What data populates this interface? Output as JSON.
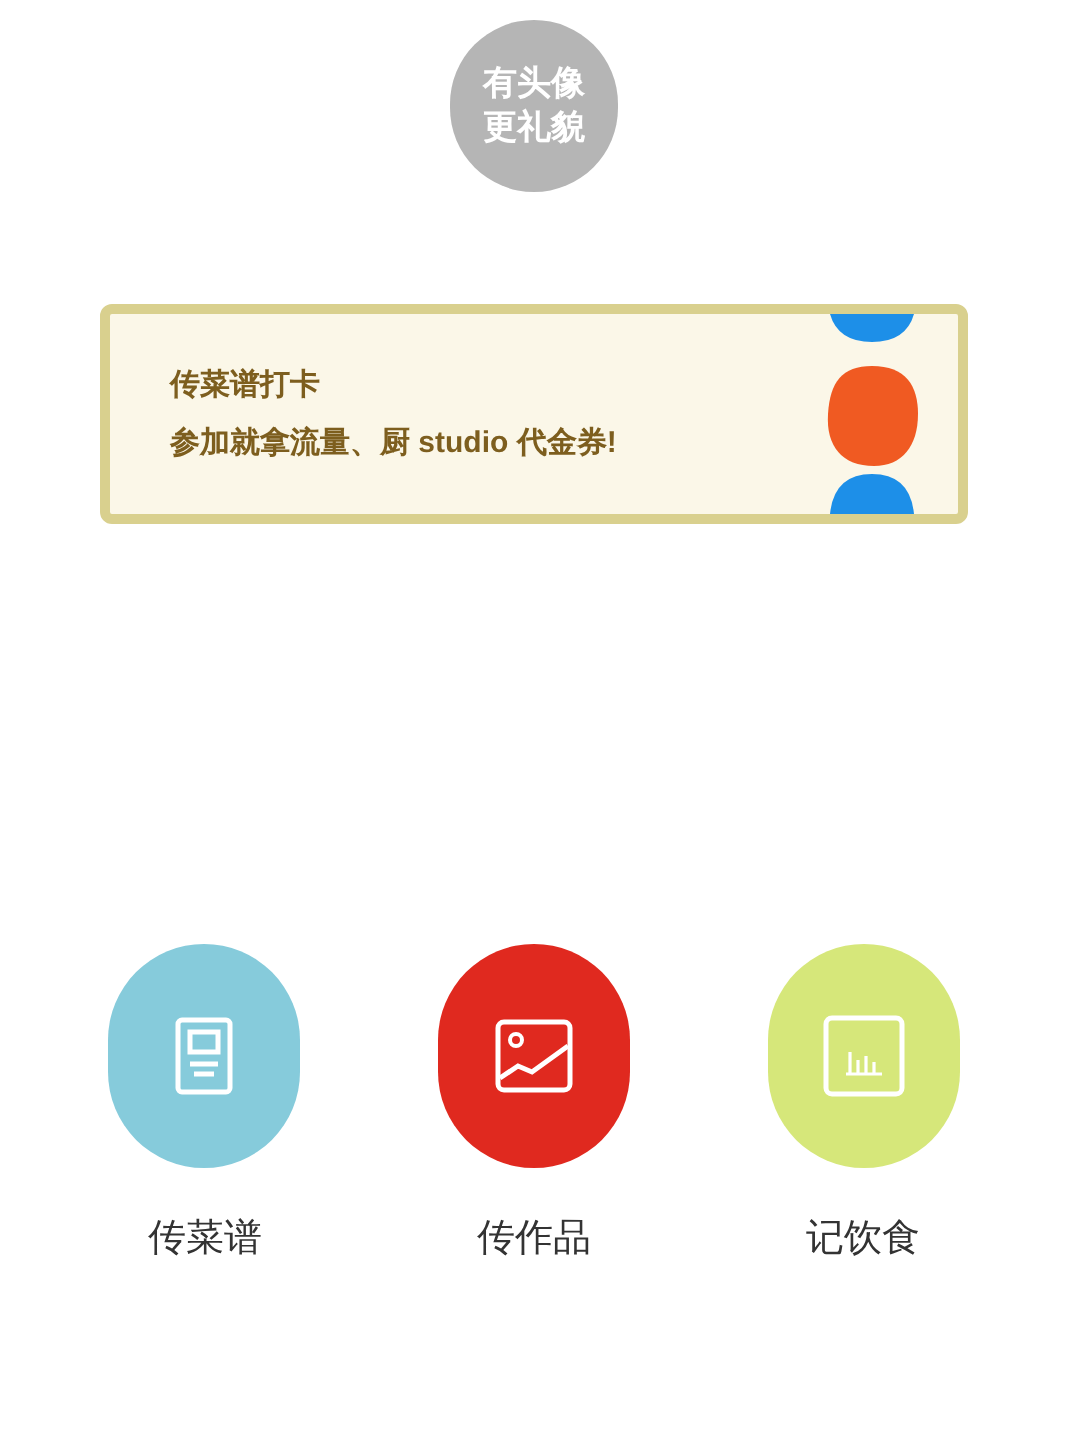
{
  "avatar": {
    "lines": [
      "有头像",
      "更礼貌"
    ]
  },
  "banner": {
    "title": "传菜谱打卡",
    "subtitle": "参加就拿流量、厨 studio 代金券!"
  },
  "actions": [
    {
      "kind": "recipe",
      "label": "传菜谱",
      "color": "#86cbdb"
    },
    {
      "kind": "photo",
      "label": "传作品",
      "color": "#e0291f"
    },
    {
      "kind": "chart",
      "label": "记饮食",
      "color": "#d6e77a"
    }
  ]
}
